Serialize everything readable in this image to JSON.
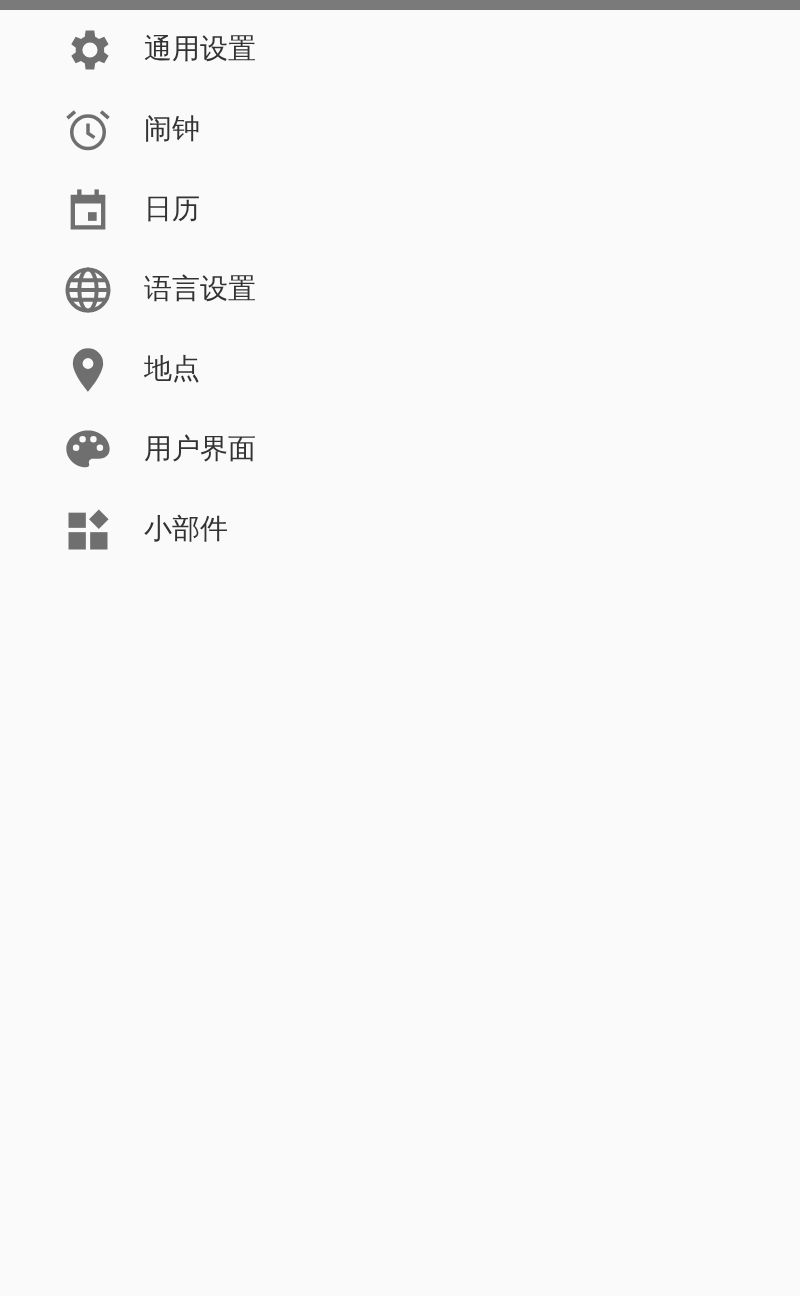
{
  "menu": {
    "items": [
      {
        "label": "通用设置",
        "kind": "gear"
      },
      {
        "label": "闹钟",
        "kind": "alarm"
      },
      {
        "label": "日历",
        "kind": "calendar"
      },
      {
        "label": "语言设置",
        "kind": "globe"
      },
      {
        "label": "地点",
        "kind": "pin"
      },
      {
        "label": "用户界面",
        "kind": "palette"
      },
      {
        "label": "小部件",
        "kind": "widgets"
      }
    ]
  }
}
